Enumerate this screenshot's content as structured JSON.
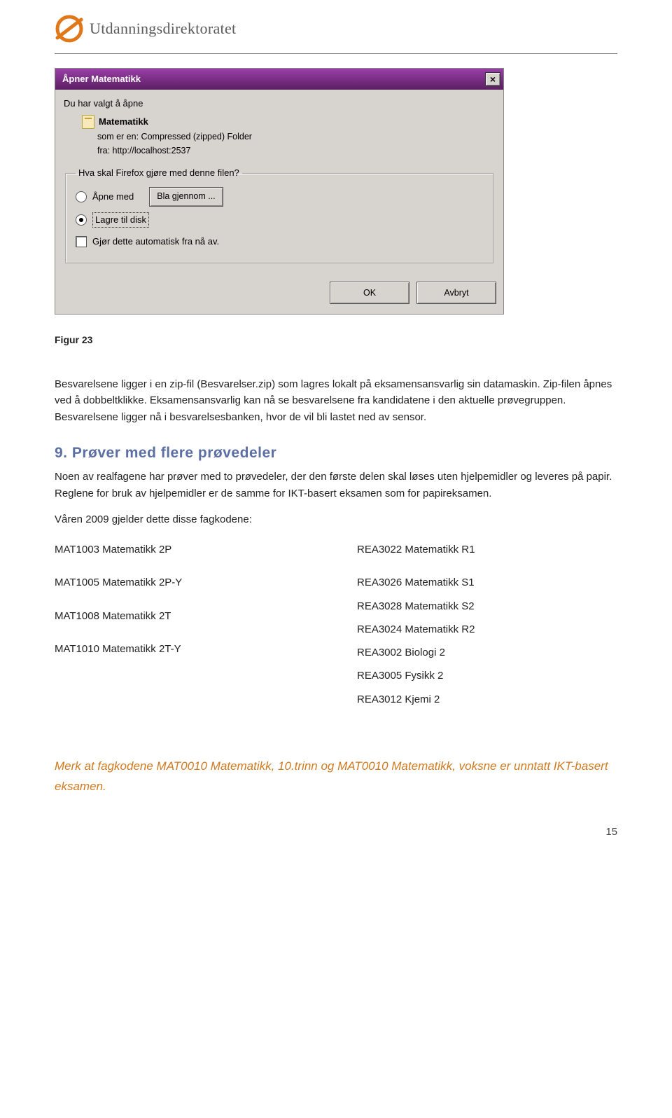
{
  "logo": {
    "text": "Utdanningsdirektoratet"
  },
  "dialog": {
    "title": "Åpner Matematikk",
    "intro": "Du har valgt å åpne",
    "filename": "Matematikk",
    "meta_type_label": "som er en:",
    "meta_type_value": "Compressed (zipped) Folder",
    "meta_from_label": "fra:",
    "meta_from_value": "http://localhost:2537",
    "group_legend": "Hva skal Firefox gjøre med denne filen?",
    "open_with": "Åpne med",
    "browse_btn": "Bla gjennom ...",
    "save_disk": "Lagre til disk",
    "auto_check": "Gjør dette automatisk fra nå av.",
    "ok": "OK",
    "cancel": "Avbryt"
  },
  "figcap": "Figur 23",
  "para1": "Besvarelsene ligger i en zip-fil (Besvarelser.zip) som lagres lokalt på eksamensansvarlig sin datamaskin. Zip-filen åpnes ved å dobbeltklikke. Eksamensansvarlig kan nå se besvarelsene fra kandidatene i den aktuelle prøvegruppen. Besvarelsene ligger nå i besvarelsesbanken, hvor de vil bli lastet ned av sensor.",
  "section_title": "9. Prøver med flere prøvedeler",
  "para2": "Noen av realfagene har prøver med to prøvedeler, der den første delen skal løses uten hjelpemidler og leveres på papir. Reglene for bruk av hjelpemidler er de samme for IKT-basert eksamen som for papireksamen.",
  "para3": "Våren 2009 gjelder dette disse fagkodene:",
  "left": {
    "a": "MAT1003 Matematikk 2P",
    "b": "MAT1005 Matematikk 2P-Y",
    "c": "MAT1008 Matematikk 2T",
    "d": "MAT1010 Matematikk 2T-Y"
  },
  "right": {
    "a": "REA3022 Matematikk R1",
    "b": "REA3026 Matematikk S1",
    "c": "REA3028 Matematikk S2",
    "d": "REA3024 Matematikk R2",
    "e": "REA3002 Biologi 2",
    "f": "REA3005 Fysikk 2",
    "g": "REA3012 Kjemi 2"
  },
  "footnote": "Merk at fagkodene MAT0010 Matematikk, 10.trinn og MAT0010 Matematikk, voksne er unntatt IKT-basert eksamen.",
  "pagenum": "15"
}
